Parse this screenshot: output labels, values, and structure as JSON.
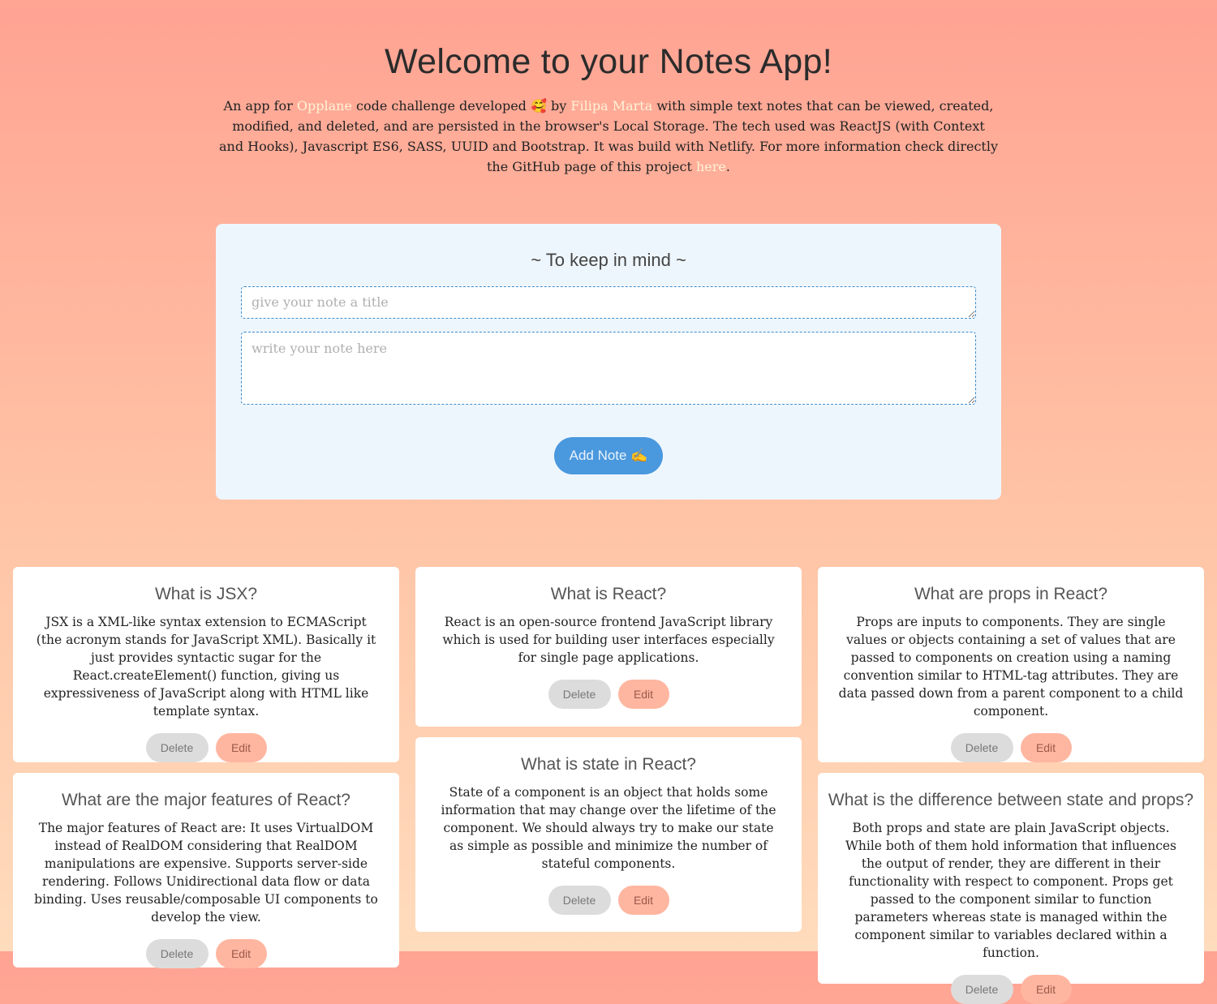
{
  "header": {
    "title": "Welcome to your Notes App!",
    "intro_1": "An app for ",
    "link_opplane": "Opplane",
    "intro_2": " code challenge developed 🥰  by ",
    "link_author": "Filipa Marta",
    "intro_3": " with simple text notes that can be viewed, created, modified, and deleted, and are persisted in the browser's Local Storage. The tech used was ReactJS (with Context and Hooks), Javascript ES6, SASS, UUID and Bootstrap. It was build with Netlify. For more information check directly the GitHub page of this project ",
    "link_here": "here",
    "intro_4": "."
  },
  "composer": {
    "heading": "~ To keep in mind ~",
    "title_placeholder": "give your note a title",
    "title_value": "",
    "note_placeholder": "write your note here",
    "note_value": "",
    "add_label": "Add Note ✍️"
  },
  "buttons": {
    "delete": "Delete",
    "edit": "Edit"
  },
  "notes": [
    {
      "title": "What is JSX?",
      "body": "JSX is a XML-like syntax extension to ECMAScript (the acronym stands for JavaScript XML). Basically it just provides syntactic sugar for the React.createElement() function, giving us expressiveness of JavaScript along with HTML like template syntax."
    },
    {
      "title": "What is React?",
      "body": "React is an open-source frontend JavaScript library which is used for building user interfaces especially for single page applications."
    },
    {
      "title": "What are props in React?",
      "body": "Props are inputs to components. They are single values or objects containing a set of values that are passed to components on creation using a naming convention similar to HTML-tag attributes. They are data passed down from a parent component to a child component."
    },
    {
      "title": "What are the major features of React?",
      "body": "The major features of React are: It uses VirtualDOM instead of RealDOM considering that RealDOM manipulations are expensive. Supports server-side rendering. Follows Unidirectional data flow or data binding. Uses reusable/composable UI components to develop the view."
    },
    {
      "title": "What is state in React?",
      "body": "State of a component is an object that holds some information that may change over the lifetime of the component. We should always try to make our state as simple as possible and minimize the number of stateful components."
    },
    {
      "title": "What is the difference between state and props?",
      "body": "Both props and state are plain JavaScript objects. While both of them hold information that influences the output of render, they are different in their functionality with respect to component. Props get passed to the component similar to function parameters whereas state is managed within the component similar to variables declared within a function."
    }
  ]
}
